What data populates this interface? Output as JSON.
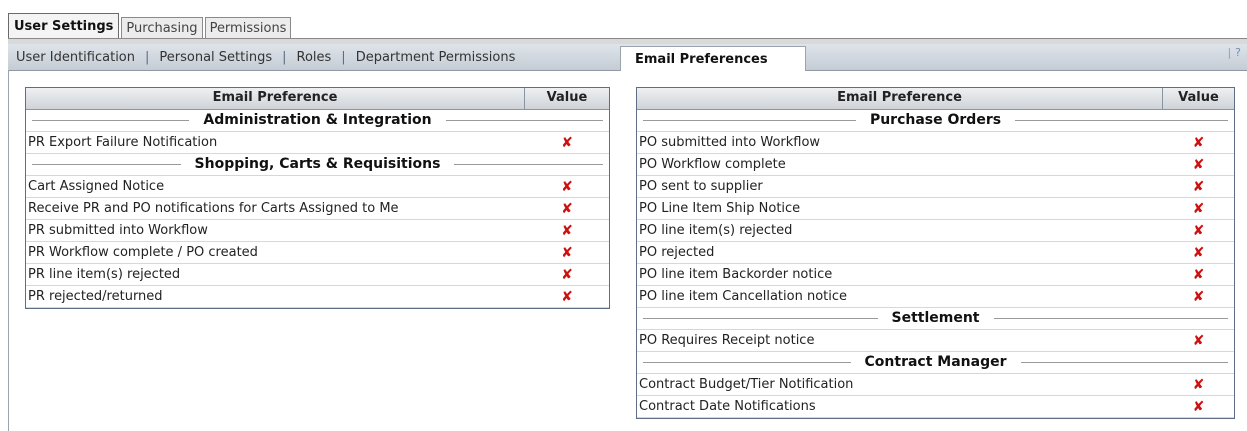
{
  "top_tabs": [
    "User Settings",
    "Purchasing",
    "Permissions"
  ],
  "subnav": {
    "items": [
      "User Identification",
      "Personal Settings",
      "Roles",
      "Department Permissions"
    ],
    "active": "Email Preferences",
    "help": "?"
  },
  "left_table": {
    "headers": {
      "preference": "Email Preference",
      "value": "Value"
    },
    "sections": [
      {
        "title": "Administration & Integration",
        "rows": [
          "PR Export Failure Notification"
        ]
      },
      {
        "title": "Shopping, Carts & Requisitions",
        "rows": [
          "Cart Assigned Notice",
          "Receive PR and PO notifications for Carts Assigned to Me",
          "PR submitted into Workflow",
          "PR Workflow complete / PO created",
          "PR line item(s) rejected",
          "PR rejected/returned"
        ]
      }
    ]
  },
  "right_table": {
    "headers": {
      "preference": "Email Preference",
      "value": "Value"
    },
    "sections": [
      {
        "title": "Purchase Orders",
        "rows": [
          "PO submitted into Workflow",
          "PO Workflow complete",
          "PO sent to supplier",
          "PO Line Item Ship Notice",
          "PO line item(s) rejected",
          "PO rejected",
          "PO line item Backorder notice",
          "PO line item Cancellation notice"
        ]
      },
      {
        "title": "Settlement",
        "rows": [
          "PO Requires Receipt notice"
        ]
      },
      {
        "title": "Contract Manager",
        "rows": [
          "Contract Budget/Tier Notification",
          "Contract Date Notifications"
        ]
      }
    ]
  },
  "value_symbol": "✘",
  "value_icon": "disabled-x-icon",
  "colors": {
    "disabled_x": "#cc1111",
    "table_border": "#5f6f83"
  }
}
